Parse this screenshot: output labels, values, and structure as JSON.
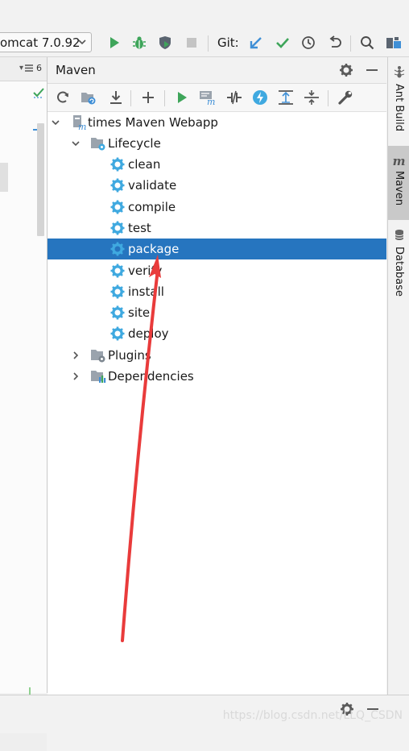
{
  "toolbar": {
    "run_config": "omcat 7.0.92",
    "git_label": "Git:",
    "icons": [
      "run-icon",
      "debug-icon",
      "coverage-icon",
      "stop-icon",
      "git-update-icon",
      "git-commit-icon",
      "history-icon",
      "rollback-icon",
      "search-icon",
      "project-structure-icon"
    ]
  },
  "left_panel": {
    "header_badge": "6"
  },
  "maven": {
    "title": "Maven",
    "toolbar_icons": [
      "reimport-icon",
      "generate-sources-icon",
      "download-icon",
      "add-icon",
      "run-icon",
      "execute-goal-icon",
      "toggle-offline-icon",
      "skip-tests-icon",
      "show-dependencies-icon",
      "collapse-all-icon",
      "settings-wrench-icon"
    ],
    "tree": {
      "project": "times Maven Webapp",
      "lifecycle": "Lifecycle",
      "goals": [
        "clean",
        "validate",
        "compile",
        "test",
        "package",
        "verify",
        "install",
        "site",
        "deploy"
      ],
      "selected_goal": "package",
      "plugins": "Plugins",
      "dependencies": "Dependencies"
    }
  },
  "right_tabs": [
    {
      "label": "Ant Build",
      "icon": "ant-icon"
    },
    {
      "label": "Maven",
      "icon": "maven-m-icon",
      "active": true
    },
    {
      "label": "Database",
      "icon": "database-icon"
    }
  ],
  "watermark": "https://blog.csdn.net/LLQ_CSDN",
  "colors": {
    "selection": "#2675bf",
    "run_green": "#3ea55a",
    "git_blue": "#3f8fd6",
    "gear_blue": "#3fa9e0",
    "annotation_red": "#e93b3b"
  }
}
